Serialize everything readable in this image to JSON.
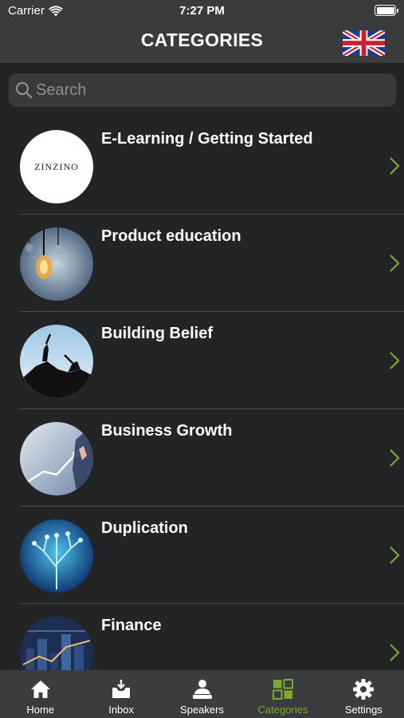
{
  "status": {
    "carrier": "Carrier",
    "time": "7:27 PM"
  },
  "header": {
    "title": "CATEGORIES",
    "language_flag": "uk-flag-icon"
  },
  "search": {
    "placeholder": "Search"
  },
  "categories": [
    {
      "label": "E-Learning / Getting Started",
      "logo_text": "ZINZINO"
    },
    {
      "label": "Product education"
    },
    {
      "label": "Building Belief"
    },
    {
      "label": "Business Growth"
    },
    {
      "label": "Duplication"
    },
    {
      "label": "Finance"
    }
  ],
  "tabbar": {
    "active_color": "#7ea82c",
    "items": [
      {
        "label": "Home",
        "icon": "home-icon"
      },
      {
        "label": "Inbox",
        "icon": "inbox-icon"
      },
      {
        "label": "Speakers",
        "icon": "speakers-icon"
      },
      {
        "label": "Categories",
        "icon": "categories-icon",
        "active": true
      },
      {
        "label": "Settings",
        "icon": "gear-icon"
      }
    ]
  },
  "colors": {
    "accent": "#7ea82c",
    "background": "#232426",
    "header": "#393b3d"
  }
}
